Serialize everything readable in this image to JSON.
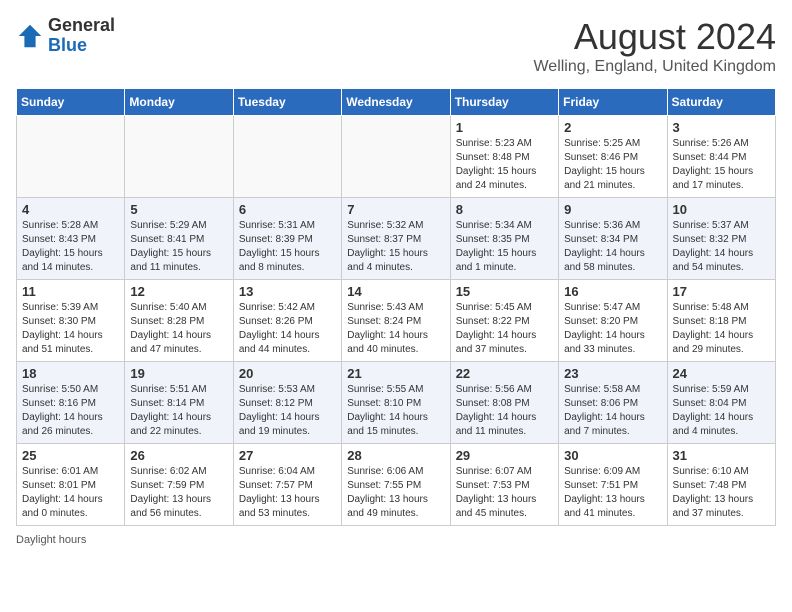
{
  "logo": {
    "general": "General",
    "blue": "Blue"
  },
  "title": {
    "month_year": "August 2024",
    "location": "Welling, England, United Kingdom"
  },
  "days_of_week": [
    "Sunday",
    "Monday",
    "Tuesday",
    "Wednesday",
    "Thursday",
    "Friday",
    "Saturday"
  ],
  "weeks": [
    [
      {
        "day": "",
        "info": ""
      },
      {
        "day": "",
        "info": ""
      },
      {
        "day": "",
        "info": ""
      },
      {
        "day": "",
        "info": ""
      },
      {
        "day": "1",
        "info": "Sunrise: 5:23 AM\nSunset: 8:48 PM\nDaylight: 15 hours\nand 24 minutes."
      },
      {
        "day": "2",
        "info": "Sunrise: 5:25 AM\nSunset: 8:46 PM\nDaylight: 15 hours\nand 21 minutes."
      },
      {
        "day": "3",
        "info": "Sunrise: 5:26 AM\nSunset: 8:44 PM\nDaylight: 15 hours\nand 17 minutes."
      }
    ],
    [
      {
        "day": "4",
        "info": "Sunrise: 5:28 AM\nSunset: 8:43 PM\nDaylight: 15 hours\nand 14 minutes."
      },
      {
        "day": "5",
        "info": "Sunrise: 5:29 AM\nSunset: 8:41 PM\nDaylight: 15 hours\nand 11 minutes."
      },
      {
        "day": "6",
        "info": "Sunrise: 5:31 AM\nSunset: 8:39 PM\nDaylight: 15 hours\nand 8 minutes."
      },
      {
        "day": "7",
        "info": "Sunrise: 5:32 AM\nSunset: 8:37 PM\nDaylight: 15 hours\nand 4 minutes."
      },
      {
        "day": "8",
        "info": "Sunrise: 5:34 AM\nSunset: 8:35 PM\nDaylight: 15 hours\nand 1 minute."
      },
      {
        "day": "9",
        "info": "Sunrise: 5:36 AM\nSunset: 8:34 PM\nDaylight: 14 hours\nand 58 minutes."
      },
      {
        "day": "10",
        "info": "Sunrise: 5:37 AM\nSunset: 8:32 PM\nDaylight: 14 hours\nand 54 minutes."
      }
    ],
    [
      {
        "day": "11",
        "info": "Sunrise: 5:39 AM\nSunset: 8:30 PM\nDaylight: 14 hours\nand 51 minutes."
      },
      {
        "day": "12",
        "info": "Sunrise: 5:40 AM\nSunset: 8:28 PM\nDaylight: 14 hours\nand 47 minutes."
      },
      {
        "day": "13",
        "info": "Sunrise: 5:42 AM\nSunset: 8:26 PM\nDaylight: 14 hours\nand 44 minutes."
      },
      {
        "day": "14",
        "info": "Sunrise: 5:43 AM\nSunset: 8:24 PM\nDaylight: 14 hours\nand 40 minutes."
      },
      {
        "day": "15",
        "info": "Sunrise: 5:45 AM\nSunset: 8:22 PM\nDaylight: 14 hours\nand 37 minutes."
      },
      {
        "day": "16",
        "info": "Sunrise: 5:47 AM\nSunset: 8:20 PM\nDaylight: 14 hours\nand 33 minutes."
      },
      {
        "day": "17",
        "info": "Sunrise: 5:48 AM\nSunset: 8:18 PM\nDaylight: 14 hours\nand 29 minutes."
      }
    ],
    [
      {
        "day": "18",
        "info": "Sunrise: 5:50 AM\nSunset: 8:16 PM\nDaylight: 14 hours\nand 26 minutes."
      },
      {
        "day": "19",
        "info": "Sunrise: 5:51 AM\nSunset: 8:14 PM\nDaylight: 14 hours\nand 22 minutes."
      },
      {
        "day": "20",
        "info": "Sunrise: 5:53 AM\nSunset: 8:12 PM\nDaylight: 14 hours\nand 19 minutes."
      },
      {
        "day": "21",
        "info": "Sunrise: 5:55 AM\nSunset: 8:10 PM\nDaylight: 14 hours\nand 15 minutes."
      },
      {
        "day": "22",
        "info": "Sunrise: 5:56 AM\nSunset: 8:08 PM\nDaylight: 14 hours\nand 11 minutes."
      },
      {
        "day": "23",
        "info": "Sunrise: 5:58 AM\nSunset: 8:06 PM\nDaylight: 14 hours\nand 7 minutes."
      },
      {
        "day": "24",
        "info": "Sunrise: 5:59 AM\nSunset: 8:04 PM\nDaylight: 14 hours\nand 4 minutes."
      }
    ],
    [
      {
        "day": "25",
        "info": "Sunrise: 6:01 AM\nSunset: 8:01 PM\nDaylight: 14 hours\nand 0 minutes."
      },
      {
        "day": "26",
        "info": "Sunrise: 6:02 AM\nSunset: 7:59 PM\nDaylight: 13 hours\nand 56 minutes."
      },
      {
        "day": "27",
        "info": "Sunrise: 6:04 AM\nSunset: 7:57 PM\nDaylight: 13 hours\nand 53 minutes."
      },
      {
        "day": "28",
        "info": "Sunrise: 6:06 AM\nSunset: 7:55 PM\nDaylight: 13 hours\nand 49 minutes."
      },
      {
        "day": "29",
        "info": "Sunrise: 6:07 AM\nSunset: 7:53 PM\nDaylight: 13 hours\nand 45 minutes."
      },
      {
        "day": "30",
        "info": "Sunrise: 6:09 AM\nSunset: 7:51 PM\nDaylight: 13 hours\nand 41 minutes."
      },
      {
        "day": "31",
        "info": "Sunrise: 6:10 AM\nSunset: 7:48 PM\nDaylight: 13 hours\nand 37 minutes."
      }
    ]
  ],
  "footer": {
    "note": "Daylight hours"
  }
}
